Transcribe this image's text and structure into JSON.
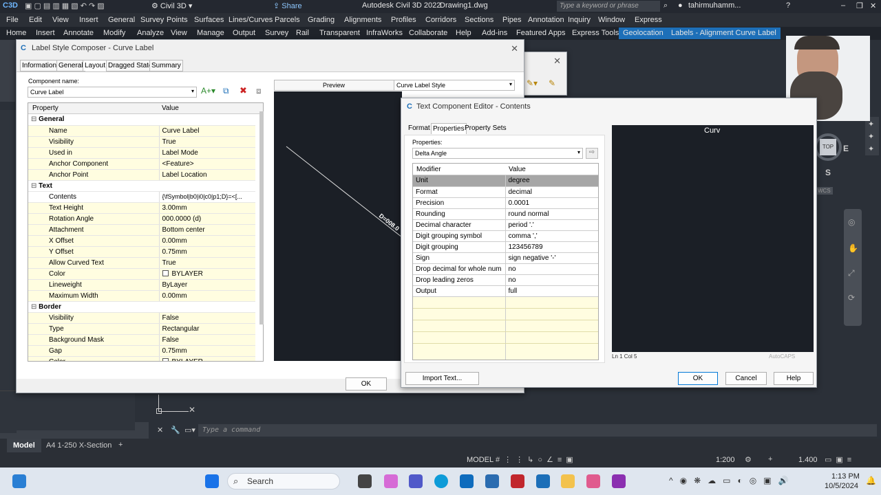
{
  "app": {
    "title": "Autodesk Civil 3D 2022",
    "file": "Drawing1.dwg",
    "workspace": "Civil 3D",
    "share": "Share",
    "search_placeholder": "Type a keyword or phrase",
    "user": "tahirmuhamm..."
  },
  "menu": [
    "File",
    "Edit",
    "View",
    "Insert",
    "General",
    "Survey",
    "Points",
    "Surfaces",
    "Lines/Curves",
    "Parcels",
    "Grading",
    "Alignments",
    "Profiles",
    "Corridors",
    "Sections",
    "Pipes",
    "Annotation",
    "Inquiry",
    "Window",
    "Express"
  ],
  "ribbon_tabs": [
    "Home",
    "Insert",
    "Annotate",
    "Modify",
    "Analyze",
    "View",
    "Manage",
    "Output",
    "Survey",
    "Rail",
    "Transparent",
    "InfraWorks",
    "Collaborate",
    "Help",
    "Add-ins",
    "Featured Apps",
    "Express Tools",
    "Geolocation",
    "Labels - Alignment Curve Label"
  ],
  "composer": {
    "title": "Label Style Composer - Curve Label",
    "tabs": [
      "Information",
      "General",
      "Layout",
      "Dragged State",
      "Summary"
    ],
    "component_label": "Component name:",
    "component_value": "Curve Label",
    "preview_label": "Preview",
    "preview_style": "Curve Label Style",
    "preview_text": "D=008.0",
    "col_property": "Property",
    "col_value": "Value",
    "rows": [
      {
        "type": "group",
        "name": "General"
      },
      {
        "name": "Name",
        "value": "Curve Label"
      },
      {
        "name": "Visibility",
        "value": "True"
      },
      {
        "name": "Used in",
        "value": "Label Mode"
      },
      {
        "name": "Anchor Component",
        "value": "<Feature>"
      },
      {
        "name": "Anchor Point",
        "value": "Label Location"
      },
      {
        "type": "group",
        "name": "Text"
      },
      {
        "name": "Contents",
        "value": "{\\fSymbol|b0|i0|c0|p1;D}=<[..."
      },
      {
        "name": "Text Height",
        "value": "3.00mm"
      },
      {
        "name": "Rotation Angle",
        "value": "000.0000 (d)"
      },
      {
        "name": "Attachment",
        "value": "Bottom center"
      },
      {
        "name": "X Offset",
        "value": "0.00mm"
      },
      {
        "name": "Y Offset",
        "value": "0.75mm"
      },
      {
        "name": "Allow Curved Text",
        "value": "True"
      },
      {
        "name": "Color",
        "value": "BYLAYER"
      },
      {
        "name": "Lineweight",
        "value": "ByLayer"
      },
      {
        "name": "Maximum Width",
        "value": "0.00mm"
      },
      {
        "type": "group",
        "name": "Border"
      },
      {
        "name": "Visibility",
        "value": "False"
      },
      {
        "name": "Type",
        "value": "Rectangular"
      },
      {
        "name": "Background Mask",
        "value": "False"
      },
      {
        "name": "Gap",
        "value": "0.75mm"
      },
      {
        "name": "Color",
        "value": "BYLAYER"
      }
    ],
    "ok": "OK"
  },
  "tce": {
    "title": "Text Component Editor - Contents",
    "tabs": [
      "Format",
      "Properties",
      "Property Sets"
    ],
    "properties_label": "Properties:",
    "properties_value": "Delta Angle",
    "col_modifier": "Modifier",
    "col_value": "Value",
    "rows": [
      {
        "name": "Unit",
        "value": "degree"
      },
      {
        "name": "Format",
        "value": "decimal"
      },
      {
        "name": "Precision",
        "value": "0.0001"
      },
      {
        "name": "Rounding",
        "value": "round normal"
      },
      {
        "name": "Decimal character",
        "value": "period '.'"
      },
      {
        "name": "Digit grouping symbol",
        "value": "comma ','"
      },
      {
        "name": "Digit grouping",
        "value": "123456789"
      },
      {
        "name": "Sign",
        "value": "sign negative '-'"
      },
      {
        "name": "Drop decimal for whole num",
        "value": "no"
      },
      {
        "name": "Drop leading zeros",
        "value": "no"
      },
      {
        "name": "Output",
        "value": "full"
      }
    ],
    "editor_text": "Curv",
    "cursor_status": "Ln 1 Col 5",
    "caps_status": "AutoCAPS",
    "import_text": "Import Text...",
    "ok": "OK",
    "cancel": "Cancel",
    "help": "Help"
  },
  "viewcube": {
    "top": "TOP",
    "east": "E",
    "south": "S",
    "wcs": "WCS"
  },
  "command": {
    "placeholder": "Type a command"
  },
  "layouts": [
    "Model",
    "A4 1-250 X-Section"
  ],
  "status": {
    "model": "MODEL",
    "scale": "1:200",
    "annoscale": "1.400"
  },
  "taskbar": {
    "search": "Search",
    "time": "1:13 PM",
    "date": "10/5/2024"
  }
}
